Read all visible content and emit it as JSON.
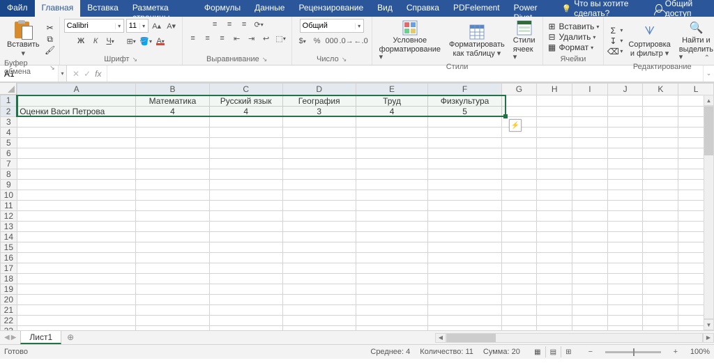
{
  "tabs": {
    "file": "Файл",
    "home": "Главная",
    "insert": "Вставка",
    "layout": "Разметка страницы",
    "formulas": "Формулы",
    "data": "Данные",
    "review": "Рецензирование",
    "view": "Вид",
    "help": "Справка",
    "pdfelement": "PDFelement",
    "powerpivot": "Power Pivot",
    "tell_me": "Что вы хотите сделать?"
  },
  "share": "Общий доступ",
  "ribbon": {
    "clipboard": {
      "paste": "Вставить",
      "label": "Буфер обмена"
    },
    "font": {
      "name": "Calibri",
      "size": "11",
      "label": "Шрифт"
    },
    "alignment": {
      "label": "Выравнивание"
    },
    "number": {
      "format": "Общий",
      "label": "Число"
    },
    "styles": {
      "cond": "Условное",
      "cond2": "форматирование",
      "table1": "Форматировать",
      "table2": "как таблицу",
      "cell1": "Стили",
      "cell2": "ячеек",
      "label": "Стили"
    },
    "cells": {
      "insert": "Вставить",
      "delete": "Удалить",
      "format": "Формат",
      "label": "Ячейки"
    },
    "editing": {
      "sort1": "Сортировка",
      "sort2": "и фильтр",
      "find1": "Найти и",
      "find2": "выделить",
      "label": "Редактирование"
    }
  },
  "namebox": "A1",
  "columns": [
    "A",
    "B",
    "C",
    "D",
    "E",
    "F",
    "G",
    "H",
    "I",
    "J",
    "K",
    "L"
  ],
  "grid": {
    "r1": [
      "",
      "Математика",
      "Русский язык",
      "География",
      "Труд",
      "Физкультура"
    ],
    "r2": [
      "Оценки Васи Петрова",
      "4",
      "4",
      "3",
      "4",
      "5"
    ]
  },
  "sheet_tab": "Лист1",
  "status": {
    "ready": "Готово",
    "avg_label": "Среднее:",
    "avg": "4",
    "count_label": "Количество:",
    "count": "11",
    "sum_label": "Сумма:",
    "sum": "20",
    "zoom": "100%"
  }
}
